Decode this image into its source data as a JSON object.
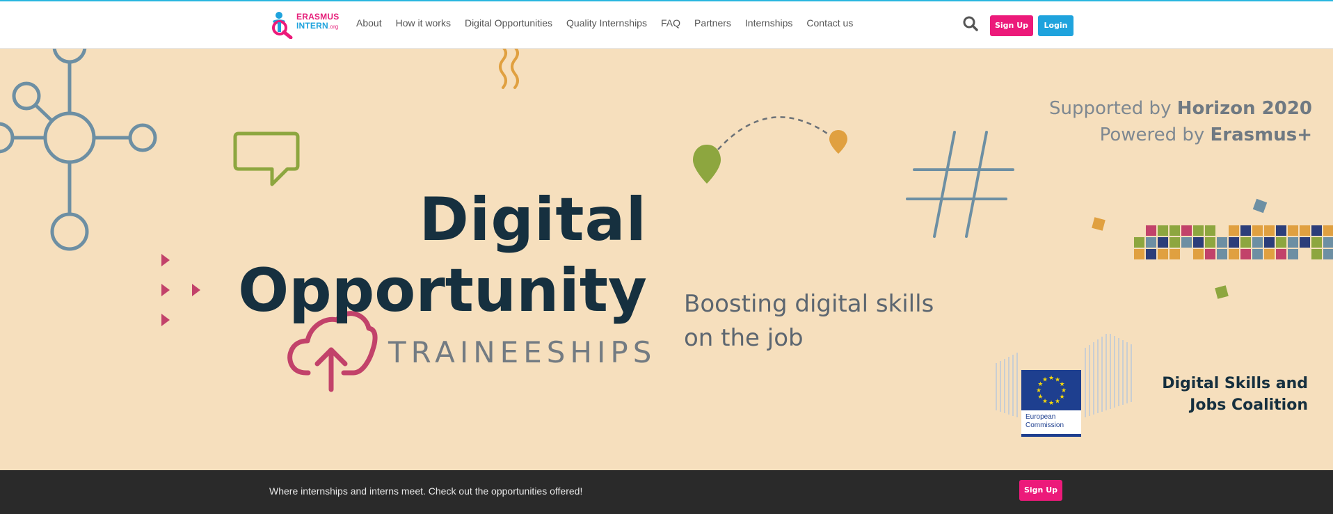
{
  "header": {
    "logo": {
      "line1": "ERASMUS",
      "line2": "INTERN",
      "suffix": ".org",
      "icon": "erasmus-intern-logo"
    },
    "nav": [
      "About",
      "How it works",
      "Digital Opportunities",
      "Quality Internships",
      "FAQ",
      "Partners",
      "Internships",
      "Contact us"
    ],
    "search_icon": "search-icon",
    "signup_label": "Sign Up",
    "login_label": "Login"
  },
  "hero": {
    "title_line1": "Digital",
    "title_line2": "Opportunity",
    "subtitle": "TRAINEESHIPS",
    "tagline_line1": "Boosting digital skills",
    "tagline_line2": "on the job",
    "supported_prefix": "Supported by",
    "supported_name": "Horizon 2020",
    "powered_prefix": "Powered by",
    "powered_name": "Erasmus+",
    "ec_line1": "European",
    "ec_line2": "Commission",
    "coalition_line1": "Digital Skills and",
    "coalition_line2": "Jobs Coalition"
  },
  "footer": {
    "text": "Where internships and interns meet. Check out the opportunities offered!",
    "signup_label": "Sign Up"
  },
  "colors": {
    "accent_pink": "#ec1a7a",
    "accent_blue": "#1fa3dd",
    "hero_bg": "#f6dfbd",
    "title_navy": "#16303f",
    "footer_bg": "#2a2a2a"
  }
}
